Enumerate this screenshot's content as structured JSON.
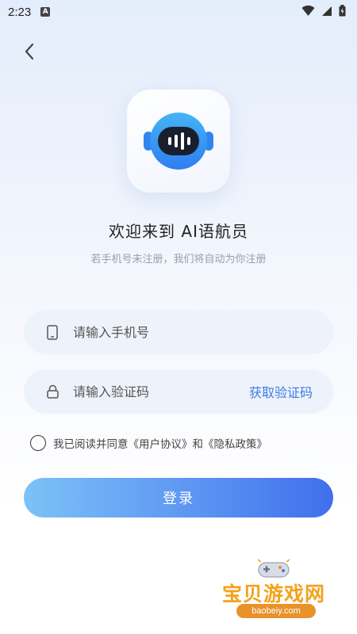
{
  "status_bar": {
    "time": "2:23",
    "notif_letter": "A"
  },
  "welcome_title": "欢迎来到 AI语航员",
  "subtitle": "若手机号未注册，我们将自动为你注册",
  "phone_field": {
    "placeholder": "请输入手机号",
    "value": ""
  },
  "code_field": {
    "placeholder": "请输入验证码",
    "value": "",
    "get_code_label": "获取验证码"
  },
  "agreement": {
    "text": "我已阅读并同意《用户协议》和《隐私政策》",
    "checked": false
  },
  "login_label": "登录",
  "watermark": {
    "title": "宝贝游戏网",
    "url": "baobeiy.com"
  },
  "colors": {
    "accent": "#3c7ce6",
    "button_start": "#7cc2f7",
    "button_end": "#3f6fec",
    "field_bg": "#eef2fa",
    "watermark": "#f3a21b"
  },
  "icons": [
    "back-icon",
    "phone-icon",
    "lock-icon",
    "robot-logo-icon",
    "wifi-icon",
    "signal-icon",
    "battery-icon"
  ]
}
